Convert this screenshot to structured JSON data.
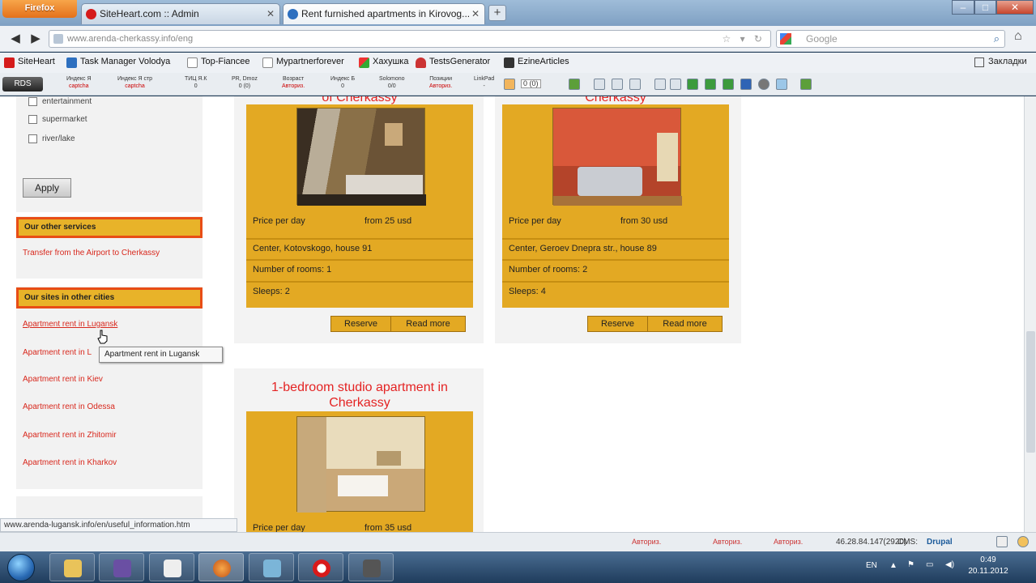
{
  "browser": {
    "app_button": "Firefox",
    "tabs": [
      {
        "label": "SiteHeart.com :: Admin"
      },
      {
        "label": "Rent furnished apartments in Kirovog..."
      }
    ],
    "url": "www.arenda-cherkassy.info/eng",
    "search_placeholder": "Google",
    "bookmarks": [
      "SiteHeart",
      "Task Manager Volodya",
      "Top-Fiancee",
      "Mypartnerforever",
      "Хахушка",
      "TestsGenerator",
      "EzineArticles"
    ],
    "bookmarks_right": "Закладки",
    "seo": {
      "rds": "RDS",
      "items": [
        {
          "label": "Индекс Я",
          "value": "captcha"
        },
        {
          "label": "Индекс Я стр",
          "value": "captcha"
        },
        {
          "label": "ТИЦ Я.К",
          "value": "0"
        },
        {
          "label": "PR, Dmoz",
          "value": "0 (0)"
        },
        {
          "label": "Возраст",
          "value": "Авториз."
        },
        {
          "label": "Индекс Б",
          "value": "0"
        },
        {
          "label": "Solomono",
          "value": "0/0"
        },
        {
          "label": "Позиции",
          "value": "Авториз."
        },
        {
          "label": "LinkPad",
          "value": "-"
        }
      ],
      "counter": "0 (0)"
    }
  },
  "sidebar": {
    "checkboxes": [
      "entertainment",
      "supermarket",
      "river/lake"
    ],
    "apply_label": "Apply",
    "services_heading": "Our other services",
    "services_link": "Transfer from the Airport to Cherkassy",
    "cities_heading": "Our sites in other cities",
    "city_links": [
      "Apartment rent in Lugansk",
      "Apartment rent in L",
      "Apartment rent in Kiev",
      "Apartment rent in Odessa",
      "Apartment rent in Zhitomir",
      "Apartment rent in Kharkov"
    ],
    "tooltip": "Apartment rent in Lugansk",
    "status_url": "www.arenda-lugansk.info/en/useful_information.htm"
  },
  "listings": [
    {
      "title_fragment": "of Cherkassy",
      "price_label": "Price per day",
      "price": "from 25 usd",
      "address": "Center, Kotovskogo, house 91",
      "rooms": "Number of rooms: 1",
      "sleeps": "Sleeps: 2",
      "reserve": "Reserve",
      "read_more": "Read more"
    },
    {
      "title_fragment": "Cherkassy",
      "price_label": "Price per day",
      "price": "from 30 usd",
      "address": "Center, Geroev Dnepra str., house 89",
      "rooms": "Number of rooms: 2",
      "sleeps": "Sleeps: 4",
      "reserve": "Reserve",
      "read_more": "Read more"
    },
    {
      "title": "1-bedroom studio apartment in Cherkassy",
      "price_label": "Price per day",
      "price": "from 35 usd"
    }
  ],
  "statusbar": {
    "ip": "46.28.84.147(2920)",
    "cms": "CMS:",
    "cms_name": "Drupal",
    "auth1": "Авториз.",
    "auth2": "Авториз.",
    "auth3": "Авториз."
  },
  "taskbar": {
    "lang": "EN",
    "time": "0:49",
    "date": "20.11.2012"
  }
}
